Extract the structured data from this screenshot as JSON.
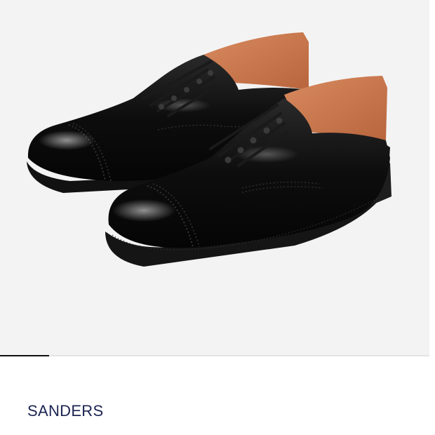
{
  "product": {
    "brand": "SANDERS",
    "image_description_icon": "black-cap-toe-derby-shoes-icon"
  },
  "carousel": {
    "current_slide": 1
  },
  "colors": {
    "image_background": "#f3f3f3",
    "brand_text": "#1c2452",
    "indicator_active": "#111111",
    "indicator_track": "#e4e4e4"
  }
}
